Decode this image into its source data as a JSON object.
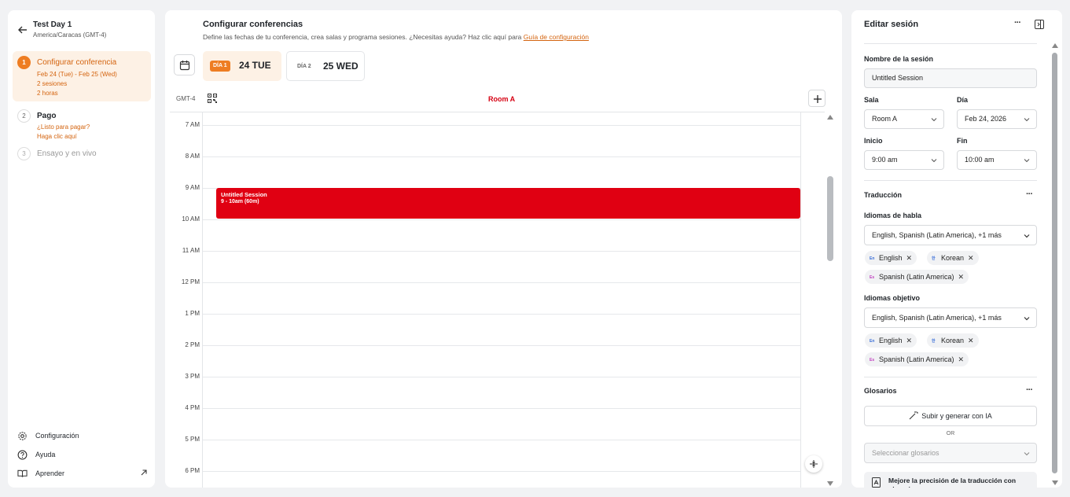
{
  "sidebar": {
    "event_title": "Test Day 1",
    "timezone": "America/Caracas (GMT-4)",
    "steps": [
      {
        "num": "1",
        "title": "Configurar conferencia",
        "sub": [
          "Feb 24 (Tue) - Feb 25 (Wed)",
          "2 sesiones",
          "2 horas"
        ]
      },
      {
        "num": "2",
        "title": "Pago",
        "sub": [
          "¿Listo para pagar?",
          "Haga clic aquí"
        ]
      },
      {
        "num": "3",
        "title": "Ensayo y en vivo"
      }
    ],
    "bottom": {
      "settings": "Configuración",
      "help": "Ayuda",
      "learn": "Aprender"
    }
  },
  "main": {
    "title": "Configurar conferencias",
    "description": "Define las fechas de tu conferencia, crea salas y programa sesiones. ¿Necesitas ayuda? Haz clic aquí para ",
    "guide_link": "Guía de configuración",
    "days": [
      {
        "badge": "DÍA 1",
        "date": "24 TUE",
        "selected": true
      },
      {
        "badge": "DÍA 2",
        "date": "25 WED",
        "selected": false
      }
    ],
    "timezone_label": "GMT-4",
    "room": "Room A",
    "hours": [
      "7 AM",
      "8 AM",
      "9 AM",
      "10 AM",
      "11 AM",
      "12 PM",
      "1 PM",
      "2 PM",
      "3 PM",
      "4 PM",
      "5 PM",
      "6 PM"
    ],
    "session": {
      "name": "Untitled Session",
      "time": "9 - 10am (60m)",
      "color": "#e00012"
    }
  },
  "panel": {
    "title": "Editar sesión",
    "session_name_label": "Nombre de la sesión",
    "session_name_value": "Untitled Session",
    "room_label": "Sala",
    "room_value": "Room A",
    "day_label": "Día",
    "day_value": "Feb 24, 2026",
    "start_label": "Inicio",
    "start_value": "9:00 am",
    "end_label": "Fin",
    "end_value": "10:00 am",
    "translation_label": "Traducción",
    "spoken_label": "Idiomas de habla",
    "spoken_value": "English, Spanish (Latin America), +1 más",
    "spoken_chips": [
      "English",
      "Korean",
      "Spanish (Latin America)"
    ],
    "target_label": "Idiomas objetivo",
    "target_value": "English, Spanish (Latin America), +1 más",
    "target_chips": [
      "English",
      "Korean",
      "Spanish (Latin America)"
    ],
    "glossary_label": "Glosarios",
    "upload_button": "Subir y generar con IA",
    "or_text": "OR",
    "glossary_select": "Seleccionar glosarios",
    "hint": "Mejore la precisión de la traducción con glosarios"
  },
  "colors": {
    "accent": "#ee7d22",
    "session": "#e00012",
    "room": "#d60012"
  }
}
